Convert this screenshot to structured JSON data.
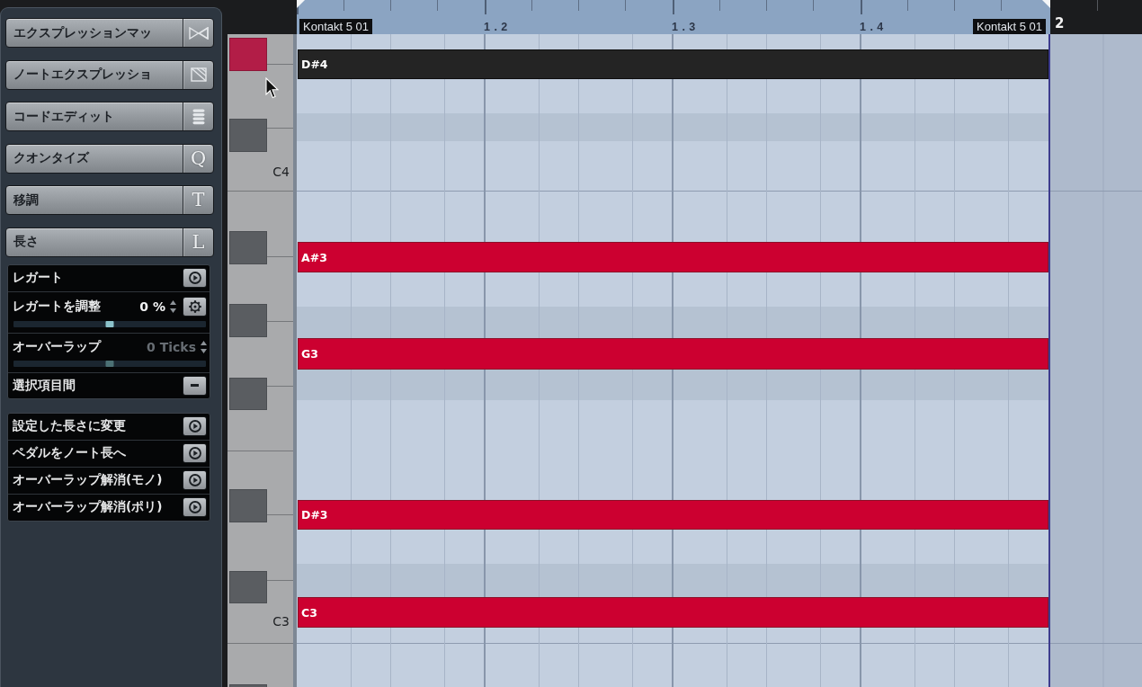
{
  "left_panel": {
    "section_buttons": [
      {
        "label": "エクスプレッションマッ",
        "kind": "icon"
      },
      {
        "label": "ノートエクスプレッショ",
        "kind": "icon"
      },
      {
        "label": "コードエディット",
        "kind": "icon"
      },
      {
        "label": "クオンタイズ",
        "kind": "key",
        "key": "Q"
      },
      {
        "label": "移調",
        "kind": "key",
        "key": "T"
      },
      {
        "label": "長さ",
        "kind": "key",
        "key": "L"
      }
    ],
    "length_options": [
      {
        "kind": "action",
        "label": "レガート"
      },
      {
        "kind": "adjust",
        "label": "レガートを調整",
        "value": "0 %",
        "disabled": false,
        "level": 0.5
      },
      {
        "kind": "value",
        "label": "オーバーラップ",
        "value": "0 Ticks",
        "disabled": true,
        "level": 0.5
      },
      {
        "kind": "switch",
        "label": "選択項目間"
      }
    ],
    "length_actions": [
      {
        "label": "設定した長さに変更"
      },
      {
        "label": "ペダルをノート長へ"
      },
      {
        "label": "オーバーラップ解消(モノ)"
      },
      {
        "label": "オーバーラップ解消(ポリ)"
      }
    ]
  },
  "ruler": {
    "part_labels": [
      "Kontakt 5 01",
      "Kontakt 5 01"
    ],
    "beat_labels": [
      "1 . 2",
      "1 . 3",
      "1 . 4"
    ],
    "bar_label": "2"
  },
  "keyboard": {
    "black_keys": [
      {
        "highlighted": true
      },
      {
        "highlighted": false
      },
      {
        "highlighted": false
      },
      {
        "highlighted": false
      },
      {
        "highlighted": false
      },
      {
        "highlighted": false
      },
      {
        "highlighted": false
      },
      {
        "highlighted": false
      }
    ],
    "octave_labels": [
      "C4",
      "C3"
    ]
  },
  "notes": [
    {
      "label": "D#4",
      "selected": true
    },
    {
      "label": "A#3",
      "selected": false
    },
    {
      "label": "G3",
      "selected": false
    },
    {
      "label": "D#3",
      "selected": false
    },
    {
      "label": "C3",
      "selected": false
    }
  ]
}
